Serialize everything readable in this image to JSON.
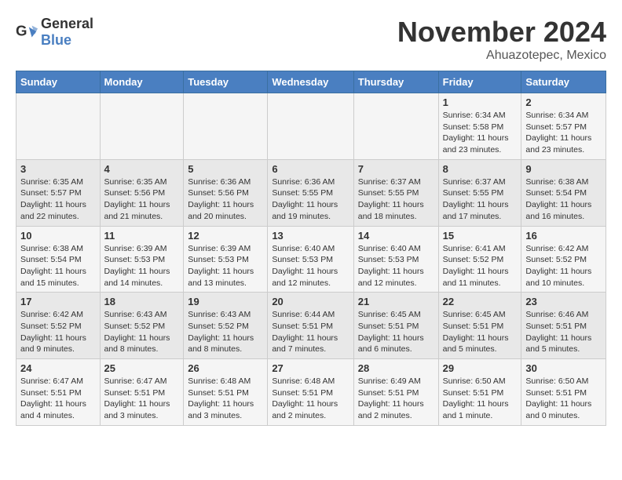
{
  "header": {
    "logo_general": "General",
    "logo_blue": "Blue",
    "month_title": "November 2024",
    "location": "Ahuazotepec, Mexico"
  },
  "weekdays": [
    "Sunday",
    "Monday",
    "Tuesday",
    "Wednesday",
    "Thursday",
    "Friday",
    "Saturday"
  ],
  "weeks": [
    {
      "days": [
        {
          "num": "",
          "info": ""
        },
        {
          "num": "",
          "info": ""
        },
        {
          "num": "",
          "info": ""
        },
        {
          "num": "",
          "info": ""
        },
        {
          "num": "",
          "info": ""
        },
        {
          "num": "1",
          "info": "Sunrise: 6:34 AM\nSunset: 5:58 PM\nDaylight: 11 hours and 23 minutes."
        },
        {
          "num": "2",
          "info": "Sunrise: 6:34 AM\nSunset: 5:57 PM\nDaylight: 11 hours and 23 minutes."
        }
      ]
    },
    {
      "days": [
        {
          "num": "3",
          "info": "Sunrise: 6:35 AM\nSunset: 5:57 PM\nDaylight: 11 hours and 22 minutes."
        },
        {
          "num": "4",
          "info": "Sunrise: 6:35 AM\nSunset: 5:56 PM\nDaylight: 11 hours and 21 minutes."
        },
        {
          "num": "5",
          "info": "Sunrise: 6:36 AM\nSunset: 5:56 PM\nDaylight: 11 hours and 20 minutes."
        },
        {
          "num": "6",
          "info": "Sunrise: 6:36 AM\nSunset: 5:55 PM\nDaylight: 11 hours and 19 minutes."
        },
        {
          "num": "7",
          "info": "Sunrise: 6:37 AM\nSunset: 5:55 PM\nDaylight: 11 hours and 18 minutes."
        },
        {
          "num": "8",
          "info": "Sunrise: 6:37 AM\nSunset: 5:55 PM\nDaylight: 11 hours and 17 minutes."
        },
        {
          "num": "9",
          "info": "Sunrise: 6:38 AM\nSunset: 5:54 PM\nDaylight: 11 hours and 16 minutes."
        }
      ]
    },
    {
      "days": [
        {
          "num": "10",
          "info": "Sunrise: 6:38 AM\nSunset: 5:54 PM\nDaylight: 11 hours and 15 minutes."
        },
        {
          "num": "11",
          "info": "Sunrise: 6:39 AM\nSunset: 5:53 PM\nDaylight: 11 hours and 14 minutes."
        },
        {
          "num": "12",
          "info": "Sunrise: 6:39 AM\nSunset: 5:53 PM\nDaylight: 11 hours and 13 minutes."
        },
        {
          "num": "13",
          "info": "Sunrise: 6:40 AM\nSunset: 5:53 PM\nDaylight: 11 hours and 12 minutes."
        },
        {
          "num": "14",
          "info": "Sunrise: 6:40 AM\nSunset: 5:53 PM\nDaylight: 11 hours and 12 minutes."
        },
        {
          "num": "15",
          "info": "Sunrise: 6:41 AM\nSunset: 5:52 PM\nDaylight: 11 hours and 11 minutes."
        },
        {
          "num": "16",
          "info": "Sunrise: 6:42 AM\nSunset: 5:52 PM\nDaylight: 11 hours and 10 minutes."
        }
      ]
    },
    {
      "days": [
        {
          "num": "17",
          "info": "Sunrise: 6:42 AM\nSunset: 5:52 PM\nDaylight: 11 hours and 9 minutes."
        },
        {
          "num": "18",
          "info": "Sunrise: 6:43 AM\nSunset: 5:52 PM\nDaylight: 11 hours and 8 minutes."
        },
        {
          "num": "19",
          "info": "Sunrise: 6:43 AM\nSunset: 5:52 PM\nDaylight: 11 hours and 8 minutes."
        },
        {
          "num": "20",
          "info": "Sunrise: 6:44 AM\nSunset: 5:51 PM\nDaylight: 11 hours and 7 minutes."
        },
        {
          "num": "21",
          "info": "Sunrise: 6:45 AM\nSunset: 5:51 PM\nDaylight: 11 hours and 6 minutes."
        },
        {
          "num": "22",
          "info": "Sunrise: 6:45 AM\nSunset: 5:51 PM\nDaylight: 11 hours and 5 minutes."
        },
        {
          "num": "23",
          "info": "Sunrise: 6:46 AM\nSunset: 5:51 PM\nDaylight: 11 hours and 5 minutes."
        }
      ]
    },
    {
      "days": [
        {
          "num": "24",
          "info": "Sunrise: 6:47 AM\nSunset: 5:51 PM\nDaylight: 11 hours and 4 minutes."
        },
        {
          "num": "25",
          "info": "Sunrise: 6:47 AM\nSunset: 5:51 PM\nDaylight: 11 hours and 3 minutes."
        },
        {
          "num": "26",
          "info": "Sunrise: 6:48 AM\nSunset: 5:51 PM\nDaylight: 11 hours and 3 minutes."
        },
        {
          "num": "27",
          "info": "Sunrise: 6:48 AM\nSunset: 5:51 PM\nDaylight: 11 hours and 2 minutes."
        },
        {
          "num": "28",
          "info": "Sunrise: 6:49 AM\nSunset: 5:51 PM\nDaylight: 11 hours and 2 minutes."
        },
        {
          "num": "29",
          "info": "Sunrise: 6:50 AM\nSunset: 5:51 PM\nDaylight: 11 hours and 1 minute."
        },
        {
          "num": "30",
          "info": "Sunrise: 6:50 AM\nSunset: 5:51 PM\nDaylight: 11 hours and 0 minutes."
        }
      ]
    }
  ]
}
